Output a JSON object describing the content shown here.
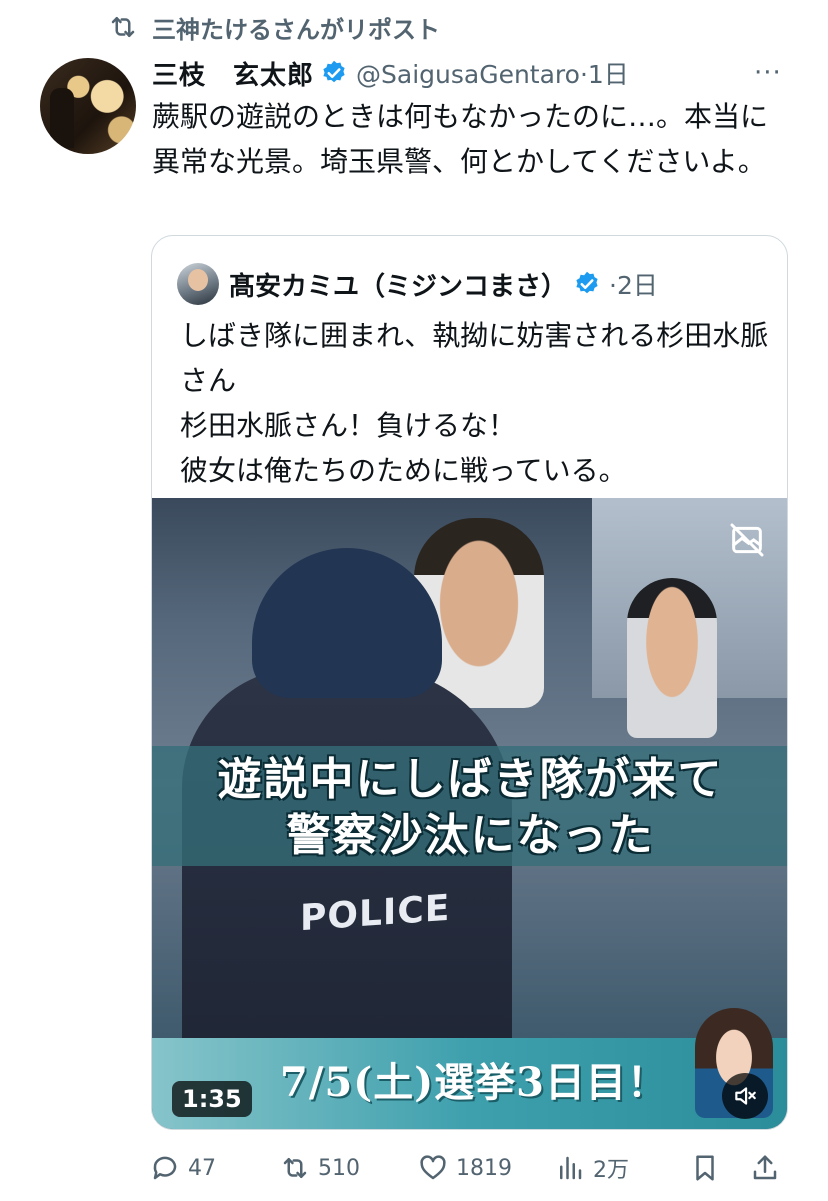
{
  "repost": {
    "text": "三神たけるさんがリポスト",
    "icon": "repost-icon"
  },
  "tweet": {
    "author_name": "三枝　玄太郎",
    "handle_time": "@SaigusaGentaro·1日",
    "more": "···",
    "text": "蕨駅の遊説のときは何もなかったのに…。本当に異常な光景。埼玉県警、何とかしてくださいよ。"
  },
  "quote": {
    "author_name": "髙安カミユ（ミジンコまさ）",
    "time": "·2日",
    "text": "しばき隊に囲まれ、執拗に妨害される杉田水脈さん\n杉田水脈さん！負けるな！\n彼女は俺たちのために戦っている。",
    "video": {
      "banner_line1": "遊説中にしばき隊が来て",
      "banner_line2": "警察沙汰になった",
      "vest_text": "POLICE",
      "bottom_text": "7/5(土)選挙3日目！",
      "duration": "1:35"
    }
  },
  "actions": {
    "replies": "47",
    "reposts": "510",
    "likes": "1819",
    "views": "2万"
  },
  "colors": {
    "verified": "#1d9bf0",
    "secondary_text": "#536471",
    "border": "#cfd9de"
  }
}
